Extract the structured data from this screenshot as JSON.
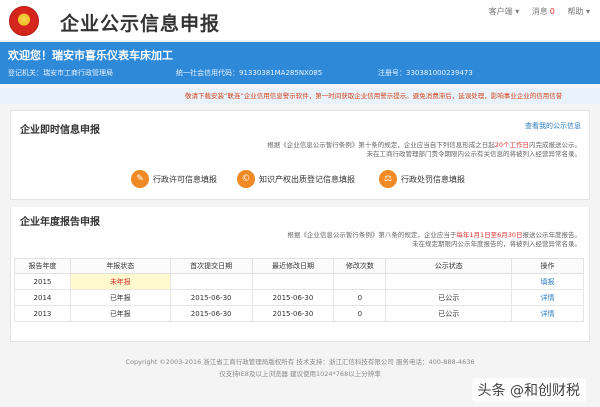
{
  "header": {
    "title": "企业公示信息申报",
    "links": [
      "客户端 ▾",
      "消息",
      "帮助 ▾"
    ],
    "message_badge": "0"
  },
  "company": {
    "welcome": "欢迎您！瑞安市喜乐仪表车床加工",
    "authority": "登记机关：瑞安市工商行政管理局",
    "credit_code": "统一社会信用代码：91330381MA285NX085",
    "reg_no": "注册号：330381000239473"
  },
  "notice": "敬请下载安装“联连”企业信用信息警示软件，第一时间获取企业信用警示提示。避免消费滞后，延误处理，影响事业企业的信用信誉",
  "instant": {
    "title": "企业即时信息申报",
    "more_link": "查看我的公示信息",
    "note_line1_a": "根据《企业信息公示暂行条例》第十条的规定，企业应当自下列信息形成之日起",
    "note_line1_hl": "20个工作日",
    "note_line1_b": "内完成报送公示。",
    "note_line2": "未在工商行政管理部门责令期限内公示有关信息的将被列入经营异常名录。",
    "actions": [
      {
        "label": "行政许可信息填报",
        "icon": "document-icon"
      },
      {
        "label": "知识产权出质登记信息填报",
        "icon": "copyright-icon"
      },
      {
        "label": "行政处罚信息填报",
        "icon": "penalty-icon"
      }
    ]
  },
  "annual": {
    "title": "企业年度报告申报",
    "note_line1_a": "根据《企业信息公示暂行条例》第八条的规定，企业应当于",
    "note_line1_hl": "每年1月1日至6月30日",
    "note_line1_b": "报送公示年度报告。",
    "note_line2": "未在规定期限内公示年度报告的，将被列入经营异常名录。",
    "columns": [
      "报告年度",
      "年报状态",
      "首次提交日期",
      "最近修改日期",
      "修改次数",
      "公示状态",
      "操作"
    ],
    "rows": [
      [
        "2015",
        "未年报",
        "",
        "",
        "",
        "",
        "填报"
      ],
      [
        "2014",
        "已年报",
        "2015-06-30",
        "2015-06-30",
        "0",
        "已公示",
        "详情"
      ],
      [
        "2013",
        "已年报",
        "2015-06-30",
        "2015-06-30",
        "0",
        "已公示",
        "详情"
      ]
    ]
  },
  "footer": {
    "line1": "Copyright ©2003-2016  浙江省工商行政管理局版权所有    技术支持：浙江汇信科技有限公司    服务电话：400-888-4636",
    "line2": "仅支持IE8及以上浏览器  建议使用1024*768以上分辨率"
  },
  "watermark": "头条 @和创财税"
}
